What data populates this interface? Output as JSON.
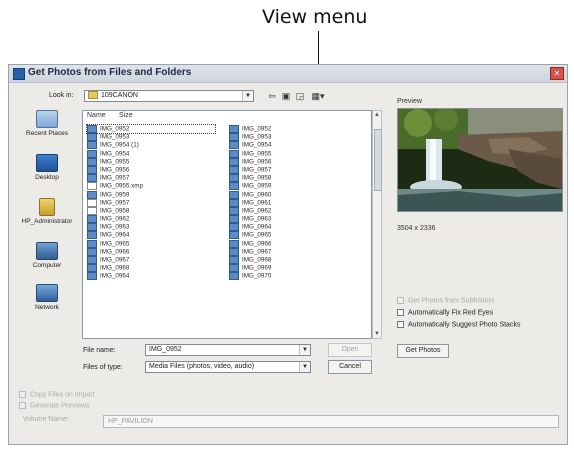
{
  "callout": {
    "label": "View menu"
  },
  "dialog": {
    "title": "Get Photos from Files and Folders",
    "look_in_label": "Look in:",
    "look_in_value": "109CANON",
    "toolbar_icons": [
      "back-arrow-icon",
      "up-folder-icon",
      "new-folder-icon",
      "view-menu-icon"
    ],
    "places": [
      "Recent Places",
      "Desktop",
      "HP_Administrator",
      "Computer",
      "Network"
    ],
    "columns": {
      "name": "Name",
      "size": "Size"
    },
    "files_left": [
      "IMG_0952",
      "IMG_0953",
      "IMG_0954 (1)",
      "IMG_0954",
      "IMG_0955",
      "IMG_0956",
      "IMG_0957",
      "IMG_0955.xmp",
      "IMG_0959",
      "IMG_0957",
      "IMG_0958",
      "IMG_0962",
      "IMG_0963",
      "IMG_0964",
      "IMG_0965",
      "IMG_0966",
      "IMG_0967",
      "IMG_0968",
      "IMG_0964"
    ],
    "files_right": [
      "IMG_0952",
      "IMG_0953",
      "IMG_0954",
      "IMG_0955",
      "IMG_0956",
      "IMG_0957",
      "IMG_0958",
      "IMG_0959",
      "IMG_0960",
      "IMG_0961",
      "IMG_0962",
      "IMG_0963",
      "IMG_0964",
      "IMG_0965",
      "IMG_0966",
      "IMG_0967",
      "IMG_0968",
      "IMG_0969",
      "IMG_0970"
    ],
    "file_name_label": "File name:",
    "file_name_value": "IMG_0952",
    "files_of_type_label": "Files of type:",
    "files_of_type_value": "Media Files (photos, video, audio)",
    "open_button": "Open",
    "cancel_button": "Cancel",
    "preview_label": "Preview",
    "preview_dims": "3504 x 2336",
    "options": {
      "get_from_subfolders": "Get Photos from Subfolders",
      "fix_red_eyes": "Automatically Fix Red Eyes",
      "suggest_stacks": "Automatically Suggest Photo Stacks"
    },
    "get_photos_button": "Get Photos",
    "copy_files": "Copy Files on Import",
    "generate_previews": "Generate Previews",
    "volume_name_label": "Volume Name:",
    "volume_name_value": "HP_PAVILION"
  }
}
